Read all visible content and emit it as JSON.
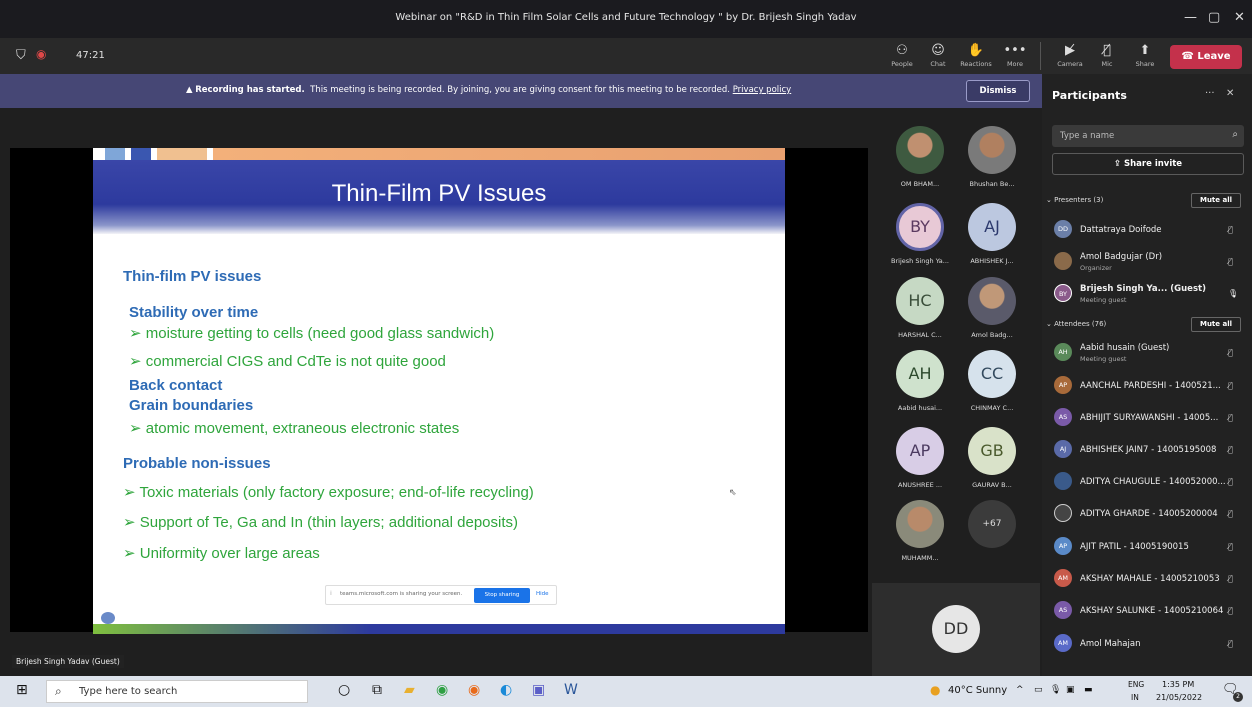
{
  "window": {
    "title": "Webinar on \"R&D in Thin Film Solar Cells and Future Technology \" by Dr. Brijesh Singh Yadav",
    "minimize_icon": "minimize-icon",
    "maximize_icon": "maximize-icon",
    "close_icon": "close-icon"
  },
  "toolbar": {
    "timer": "47:21",
    "buttons": [
      {
        "label": "People",
        "icon": "people-icon"
      },
      {
        "label": "Chat",
        "icon": "chat-icon"
      },
      {
        "label": "Reactions",
        "icon": "reactions-icon"
      },
      {
        "label": "More",
        "icon": "more-icon"
      },
      {
        "label": "Camera",
        "icon": "camera-off-icon"
      },
      {
        "label": "Mic",
        "icon": "mic-off-icon"
      },
      {
        "label": "Share",
        "icon": "share-icon"
      }
    ],
    "leave_label": "Leave"
  },
  "banner": {
    "bold": "Recording has started.",
    "text": "This meeting is being recorded. By joining, you are giving consent for this meeting to be recorded.",
    "link": "Privacy policy",
    "dismiss": "Dismiss"
  },
  "slide": {
    "title": "Thin-Film PV Issues",
    "lines": [
      {
        "text": "Thin-film PV issues",
        "style": "heading"
      },
      {
        "text": "Stability over time",
        "style": "heading"
      },
      {
        "text": "➢ moisture getting to cells (need good glass sandwich)",
        "style": "body"
      },
      {
        "text": "➢ commercial CIGS and CdTe is not quite good",
        "style": "body"
      },
      {
        "text": "Back contact",
        "style": "heading"
      },
      {
        "text": "Grain boundaries",
        "style": "heading"
      },
      {
        "text": "➢ atomic movement, extraneous electronic states",
        "style": "body"
      },
      {
        "text": "Probable non-issues",
        "style": "heading"
      },
      {
        "text": "➢ Toxic materials (only factory exposure; end-of-life recycling)",
        "style": "body"
      },
      {
        "text": "➢ Support of Te, Ga and In (thin layers; additional deposits)",
        "style": "body"
      },
      {
        "text": "➢ Uniformity over large areas",
        "style": "body"
      }
    ]
  },
  "share_notice": {
    "text": "teams.microsoft.com is sharing your screen.",
    "stop": "Stop sharing",
    "hide": "Hide"
  },
  "presenter_label": "Brijesh Singh Yadav (Guest)",
  "gallery": [
    {
      "name": "OM BHAM...",
      "initials": "",
      "kind": "photo"
    },
    {
      "name": "Bhushan Be...",
      "initials": "",
      "kind": "photo"
    },
    {
      "name": "Brijesh Singh Ya...",
      "initials": "BY",
      "kind": "by"
    },
    {
      "name": "ABHISHEK J...",
      "initials": "AJ",
      "kind": "aj"
    },
    {
      "name": "HARSHAL C...",
      "initials": "HC",
      "kind": "hc"
    },
    {
      "name": "Amol Badg...",
      "initials": "",
      "kind": "photo"
    },
    {
      "name": "Aabid husai...",
      "initials": "AH",
      "kind": "ah"
    },
    {
      "name": "CHINMAY C...",
      "initials": "CC",
      "kind": "cc"
    },
    {
      "name": "ANUSHREE ...",
      "initials": "AP",
      "kind": "ap"
    },
    {
      "name": "GAURAV B...",
      "initials": "GB",
      "kind": "gb"
    },
    {
      "name": "MUHAMM...",
      "initials": "",
      "kind": "photo"
    },
    {
      "name": "",
      "initials": "+67",
      "kind": "more"
    }
  ],
  "self_tile": {
    "initials": "DD"
  },
  "participants": {
    "title": "Participants",
    "search_placeholder": "Type a name",
    "share_invite": "Share invite",
    "presenters_label": "Presenters (3)",
    "attendees_label": "Attendees (76)",
    "mute_all": "Mute all",
    "presenters": [
      {
        "initials": "DD",
        "name": "Dattatraya Doifode",
        "sub": "",
        "color": "#6b7fa8"
      },
      {
        "initials": "",
        "name": "Amol Badgujar (Dr)",
        "sub": "Organizer",
        "color": "#8a6a4a"
      },
      {
        "initials": "BY",
        "name": "Brijesh Singh Ya... (Guest)",
        "sub": "Meeting guest",
        "color": "#8a5a8a"
      }
    ],
    "attendees": [
      {
        "initials": "AH",
        "name": "Aabid husain (Guest)",
        "sub": "Meeting guest",
        "color": "#5a8a5a"
      },
      {
        "initials": "AP",
        "name": "AANCHAL PARDESHI - 1400521...",
        "sub": "",
        "color": "#a86a3a"
      },
      {
        "initials": "AS",
        "name": "ABHIJIT SURYAWANSHI - 14005...",
        "sub": "",
        "color": "#7a5aa8"
      },
      {
        "initials": "AJ",
        "name": "ABHISHEK JAIN7 - 14005195008",
        "sub": "",
        "color": "#5a6aa8"
      },
      {
        "initials": "",
        "name": "ADITYA CHAUGULE - 140052000...",
        "sub": "",
        "color": "#3a5a8a"
      },
      {
        "initials": "",
        "name": "ADITYA GHARDE - 14005200004",
        "sub": "",
        "color": "#444444"
      },
      {
        "initials": "AP",
        "name": "AJIT PATIL - 14005190015",
        "sub": "",
        "color": "#5a8ac8"
      },
      {
        "initials": "AM",
        "name": "AKSHAY MAHALE - 14005210053",
        "sub": "",
        "color": "#c85a4a"
      },
      {
        "initials": "AS",
        "name": "AKSHAY SALUNKE - 14005210064",
        "sub": "",
        "color": "#7a5aa8"
      },
      {
        "initials": "AM",
        "name": "Amol Mahajan",
        "sub": "",
        "color": "#5a6ac8"
      }
    ]
  },
  "taskbar": {
    "search_placeholder": "Type here to search",
    "weather": "40°C Sunny",
    "lang": "ENG",
    "region": "IN",
    "time": "1:35 PM",
    "date": "21/05/2022",
    "notifications": "2"
  }
}
